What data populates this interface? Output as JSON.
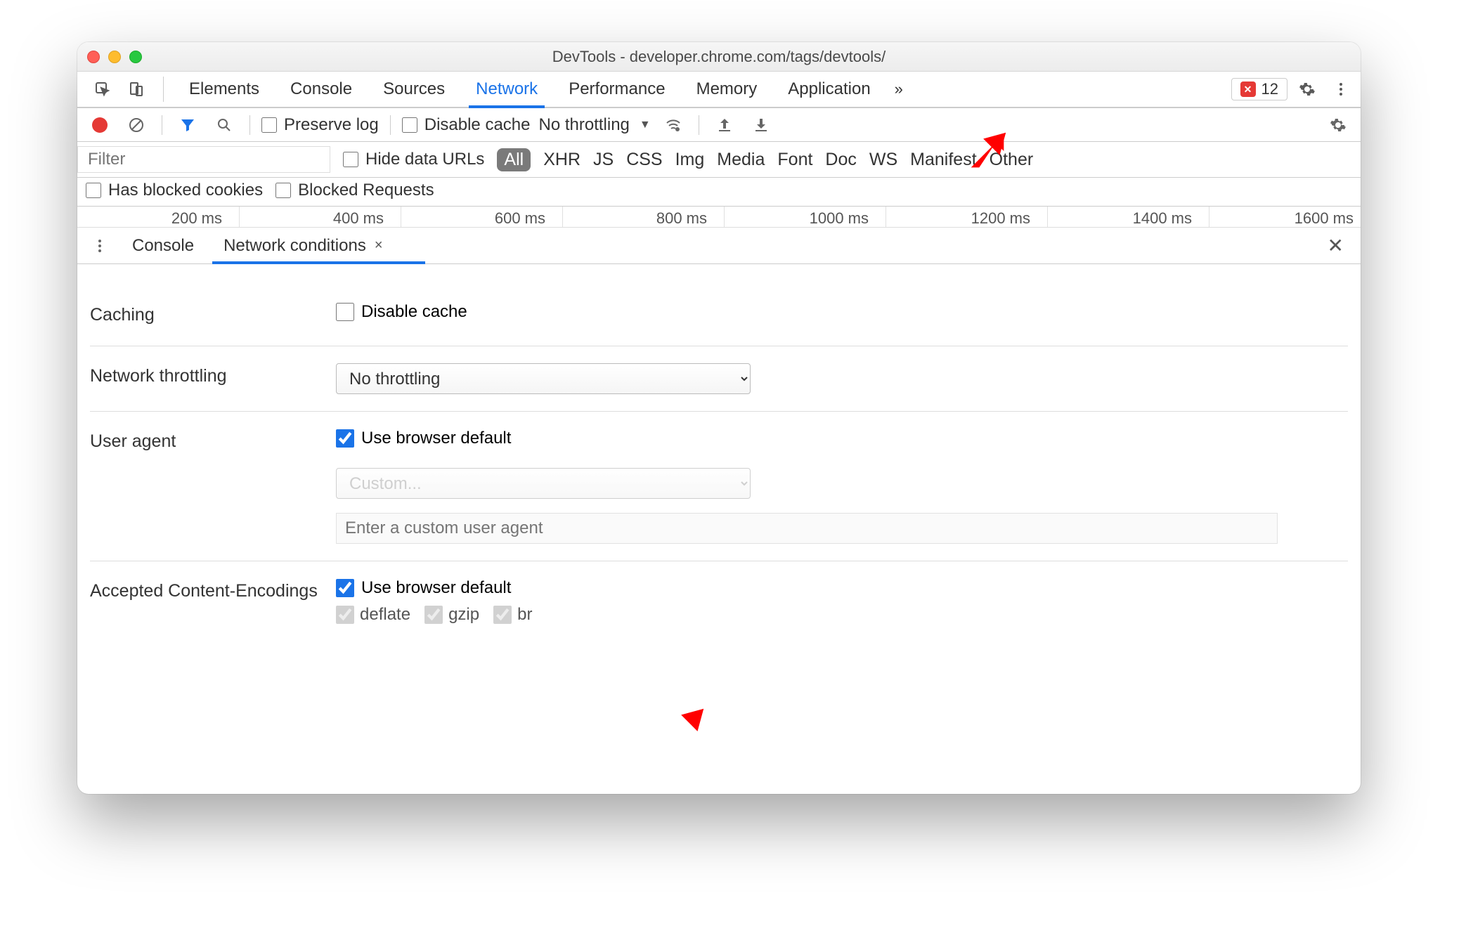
{
  "window": {
    "title": "DevTools - developer.chrome.com/tags/devtools/"
  },
  "main_tabs": {
    "items": [
      "Elements",
      "Console",
      "Sources",
      "Network",
      "Performance",
      "Memory",
      "Application"
    ],
    "active_index": 3,
    "more": "»",
    "errors_count": "12"
  },
  "toolbar": {
    "preserve_log": "Preserve log",
    "disable_cache": "Disable cache",
    "throttling": "No throttling"
  },
  "filters": {
    "filter_placeholder": "Filter",
    "hide_data_urls": "Hide data URLs",
    "types": [
      "All",
      "XHR",
      "JS",
      "CSS",
      "Img",
      "Media",
      "Font",
      "Doc",
      "WS",
      "Manifest",
      "Other"
    ],
    "active_type_index": 0,
    "has_blocked_cookies": "Has blocked cookies",
    "blocked_requests": "Blocked Requests"
  },
  "timeline": {
    "ticks": [
      "200 ms",
      "400 ms",
      "600 ms",
      "800 ms",
      "1000 ms",
      "1200 ms",
      "1400 ms",
      "1600 ms"
    ]
  },
  "drawer": {
    "tabs": [
      "Console",
      "Network conditions"
    ],
    "active_index": 1,
    "close_tab": "×"
  },
  "conditions": {
    "caching_label": "Caching",
    "caching_disable_cache": "Disable cache",
    "throttling_label": "Network throttling",
    "throttling_value": "No throttling",
    "user_agent_label": "User agent",
    "user_agent_default": "Use browser default",
    "user_agent_select_placeholder": "Custom...",
    "user_agent_input_placeholder": "Enter a custom user agent",
    "encodings_label": "Accepted Content-Encodings",
    "encodings_default": "Use browser default",
    "encodings_items": [
      "deflate",
      "gzip",
      "br"
    ]
  }
}
